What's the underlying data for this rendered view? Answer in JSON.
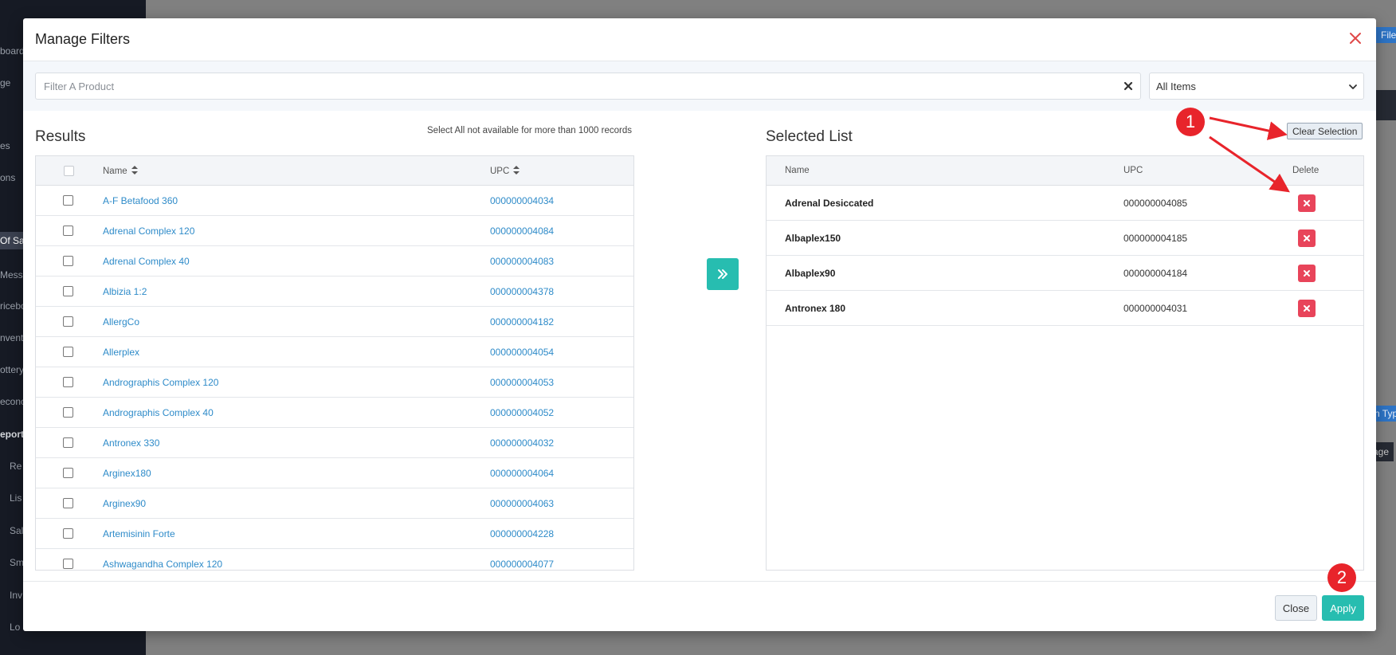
{
  "background": {
    "sidebar_items": [
      "board",
      "ge",
      "es",
      "ons",
      "Of Sal",
      "Messa",
      "ricebo",
      "nvent",
      "ottery",
      "econc",
      "eport",
      "Re",
      "Lis",
      "Sal",
      "Sm",
      "Inv",
      "Lo"
    ],
    "fragments": {
      "files": "Files",
      "type": "n Typ",
      "page": "age"
    }
  },
  "modal": {
    "title": "Manage Filters",
    "filter": {
      "placeholder": "Filter A Product",
      "value": ""
    },
    "select": {
      "selected": "All Items"
    },
    "results": {
      "title": "Results",
      "note": "Select All not available for more than 1000 records",
      "columns": {
        "name": "Name",
        "upc": "UPC"
      },
      "rows": [
        {
          "name": "A-F Betafood 360",
          "upc": "000000004034"
        },
        {
          "name": "Adrenal Complex 120",
          "upc": "000000004084"
        },
        {
          "name": "Adrenal Complex 40",
          "upc": "000000004083"
        },
        {
          "name": "Albizia 1:2",
          "upc": "000000004378"
        },
        {
          "name": "AllergCo",
          "upc": "000000004182"
        },
        {
          "name": "Allerplex",
          "upc": "000000004054"
        },
        {
          "name": "Andrographis Complex 120",
          "upc": "000000004053"
        },
        {
          "name": "Andrographis Complex 40",
          "upc": "000000004052"
        },
        {
          "name": "Antronex 330",
          "upc": "000000004032"
        },
        {
          "name": "Arginex180",
          "upc": "000000004064"
        },
        {
          "name": "Arginex90",
          "upc": "000000004063"
        },
        {
          "name": "Artemisinin Forte",
          "upc": "000000004228"
        },
        {
          "name": "Ashwagandha Complex 120",
          "upc": "000000004077"
        }
      ]
    },
    "selected": {
      "title": "Selected List",
      "clear_label": "Clear Selection",
      "columns": {
        "name": "Name",
        "upc": "UPC",
        "delete": "Delete"
      },
      "rows": [
        {
          "name": "Adrenal Desiccated",
          "upc": "000000004085"
        },
        {
          "name": "Albaplex150",
          "upc": "000000004185"
        },
        {
          "name": "Albaplex90",
          "upc": "000000004184"
        },
        {
          "name": "Antronex 180",
          "upc": "000000004031"
        }
      ]
    },
    "footer": {
      "close_label": "Close",
      "apply_label": "Apply"
    }
  },
  "annotations": {
    "badge1": "1",
    "badge2": "2"
  },
  "colors": {
    "accent": "#27bdb0",
    "danger": "#e8445a",
    "link": "#2e8bc9",
    "annotation": "#e8242b"
  }
}
